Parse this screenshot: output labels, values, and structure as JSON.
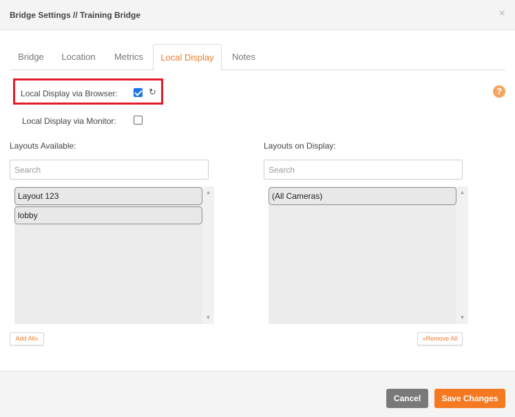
{
  "header": {
    "title": "Bridge Settings // Training Bridge",
    "close": "×"
  },
  "tabs": [
    {
      "label": "Bridge",
      "active": false
    },
    {
      "label": "Location",
      "active": false
    },
    {
      "label": "Metrics",
      "active": false
    },
    {
      "label": "Local Display",
      "active": true
    },
    {
      "label": "Notes",
      "active": false
    }
  ],
  "options": {
    "browser": {
      "label": "Local Display via Browser:",
      "checked": true
    },
    "monitor": {
      "label": "Local Display via Monitor:",
      "checked": false
    }
  },
  "help": "?",
  "available": {
    "label": "Layouts Available:",
    "search_placeholder": "Search",
    "items": [
      "Layout 123",
      "lobby"
    ],
    "button": "Add All»"
  },
  "on_display": {
    "label": "Layouts on Display:",
    "search_placeholder": "Search",
    "items": [
      "(All Cameras)"
    ],
    "button": "«Remove All"
  },
  "footer": {
    "cancel": "Cancel",
    "save": "Save Changes"
  },
  "colors": {
    "accent": "#ee7b2f",
    "highlight": "#e11d28",
    "checkbox": "#1a73e8"
  },
  "icons": {
    "undo": "undo-icon",
    "help": "help-icon",
    "close": "close-icon"
  }
}
